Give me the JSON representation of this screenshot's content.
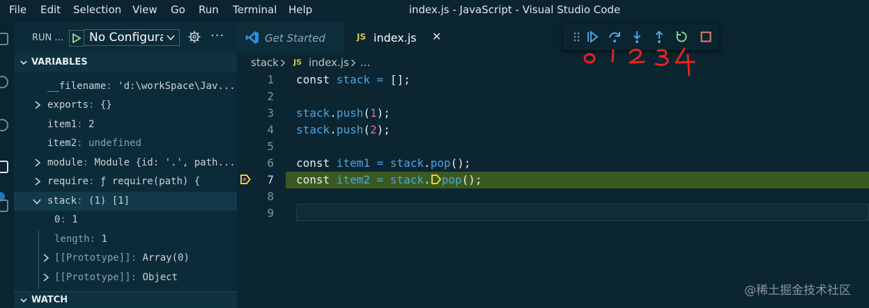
{
  "menu": {
    "items": [
      "File",
      "Edit",
      "Selection",
      "View",
      "Go",
      "Run",
      "Terminal",
      "Help"
    ],
    "window_title": "index.js - JavaScript - Visual Studio Code"
  },
  "sidebar": {
    "run_label": "RUN ...",
    "config_select": "No Configurat",
    "variables_title": "VARIABLES",
    "watch_title": "WATCH",
    "variables": [
      {
        "name": "__filename",
        "sep": ": ",
        "value": "'d:\\workSpace\\Jav..."
      },
      {
        "name": "exports",
        "sep": ": ",
        "value": "{}"
      },
      {
        "name": "item1",
        "sep": ": ",
        "value": "2"
      },
      {
        "name": "item2",
        "sep": ": ",
        "value": "undefined"
      },
      {
        "name": "module",
        "sep": ": ",
        "value": "Module {id: '.', path..."
      },
      {
        "name": "require",
        "sep": ": ",
        "value": "ƒ require(path) {"
      },
      {
        "name": "stack",
        "sep": ": ",
        "value": "(1) [1]"
      },
      {
        "name": "0",
        "sep": ": ",
        "value": "1"
      },
      {
        "name": "length",
        "sep": ": ",
        "value": "1"
      },
      {
        "name": "[[Prototype]]",
        "sep": ": ",
        "value": "Array(0)"
      },
      {
        "name": "[[Prototype]]",
        "sep": ": ",
        "value": "Object"
      }
    ]
  },
  "tabs": {
    "get_started": "Get Started",
    "index_js_badge": "JS",
    "index_js": "index.js",
    "close": "✕"
  },
  "breadcrumb": {
    "folder": "stack",
    "js_badge": "JS",
    "file": "index.js",
    "more": "..."
  },
  "code": {
    "line_numbers": [
      "1",
      "2",
      "3",
      "4",
      "5",
      "6",
      "7",
      "8",
      "9"
    ],
    "lines": [
      [
        {
          "t": "kw",
          "v": "const "
        },
        {
          "t": "id",
          "v": "stack"
        },
        {
          "t": "op",
          "v": " = "
        },
        {
          "t": "kw",
          "v": "[];"
        }
      ],
      [],
      [
        {
          "t": "id",
          "v": "stack"
        },
        {
          "t": "kw",
          "v": "."
        },
        {
          "t": "id",
          "v": "push"
        },
        {
          "t": "kw",
          "v": "("
        },
        {
          "t": "num",
          "v": "1"
        },
        {
          "t": "kw",
          "v": ");"
        }
      ],
      [
        {
          "t": "id",
          "v": "stack"
        },
        {
          "t": "kw",
          "v": "."
        },
        {
          "t": "id",
          "v": "push"
        },
        {
          "t": "kw",
          "v": "("
        },
        {
          "t": "num",
          "v": "2"
        },
        {
          "t": "kw",
          "v": ");"
        }
      ],
      [],
      [
        {
          "t": "kw",
          "v": "const "
        },
        {
          "t": "id",
          "v": "item1"
        },
        {
          "t": "op",
          "v": " = "
        },
        {
          "t": "id",
          "v": "stack"
        },
        {
          "t": "kw",
          "v": "."
        },
        {
          "t": "id",
          "v": "pop"
        },
        {
          "t": "kw",
          "v": "();"
        }
      ],
      [
        {
          "t": "kw",
          "v": "const "
        },
        {
          "t": "id",
          "v": "item2"
        },
        {
          "t": "op",
          "v": " = "
        },
        {
          "t": "id",
          "v": "stack"
        },
        {
          "t": "kw",
          "v": "."
        },
        {
          "t": "mark",
          "v": ""
        },
        {
          "t": "id",
          "v": "pop"
        },
        {
          "t": "kw",
          "v": "();"
        }
      ],
      [],
      []
    ],
    "current_line": "7"
  },
  "debug_toolbar": {
    "buttons": [
      "grip-icon",
      "continue-icon",
      "step-over-icon",
      "step-into-icon",
      "step-out-icon",
      "restart-icon",
      "stop-icon"
    ],
    "annotation": [
      "0",
      "1",
      "2",
      "3",
      "4"
    ]
  },
  "colors": {
    "annotation": "#e8231f",
    "current_line": "#3b5a20",
    "debug_blue": "#4fa3e0",
    "restart_green": "#89d185"
  },
  "watermark": "@稀土掘金技术社区"
}
